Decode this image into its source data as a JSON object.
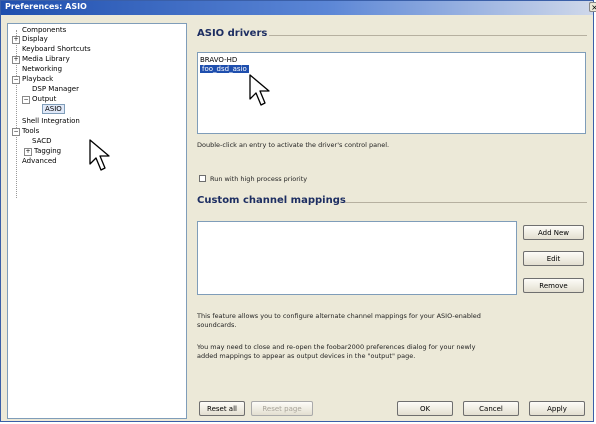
{
  "window": {
    "title": "Preferences: ASIO",
    "help_glyph": "?",
    "close_glyph": "×"
  },
  "tree": {
    "items": [
      {
        "label": "Components",
        "expander": ""
      },
      {
        "label": "Display",
        "expander": "+"
      },
      {
        "label": "Keyboard Shortcuts",
        "expander": ""
      },
      {
        "label": "Media Library",
        "expander": "+"
      },
      {
        "label": "Networking",
        "expander": ""
      },
      {
        "label": "Playback",
        "expander": "−"
      },
      {
        "label": "DSP Manager",
        "expander": ""
      },
      {
        "label": "Output",
        "expander": "−"
      },
      {
        "label": "ASIO",
        "expander": "",
        "selected": true
      },
      {
        "label": "Shell Integration",
        "expander": ""
      },
      {
        "label": "Tools",
        "expander": "−"
      },
      {
        "label": "SACD",
        "expander": ""
      },
      {
        "label": "Tagging",
        "expander": "+"
      },
      {
        "label": "Advanced",
        "expander": ""
      }
    ]
  },
  "asio_drivers": {
    "heading": "ASIO drivers",
    "drivers": [
      "BRAVO-HD",
      "foo_dsd_asio"
    ],
    "selected_index": 1,
    "hint": "Double-click an entry to activate the driver's control panel.",
    "high_priority_label": "Run with high process priority",
    "high_priority_checked": false
  },
  "mappings": {
    "heading": "Custom channel mappings",
    "add_new": "Add New",
    "edit": "Edit",
    "remove": "Remove",
    "note1_line1": "This feature allows you to configure alternate channel mappings for your ASIO-enabled",
    "note1_line2": "soundcards.",
    "note2_line1": "You may need to close and re-open the foobar2000 preferences dialog for your newly",
    "note2_line2": "added mappings to appear as output devices in the \"output\" page."
  },
  "footer": {
    "reset_all": "Reset all",
    "reset_page": "Reset page",
    "ok": "OK",
    "cancel": "Cancel",
    "apply": "Apply"
  }
}
